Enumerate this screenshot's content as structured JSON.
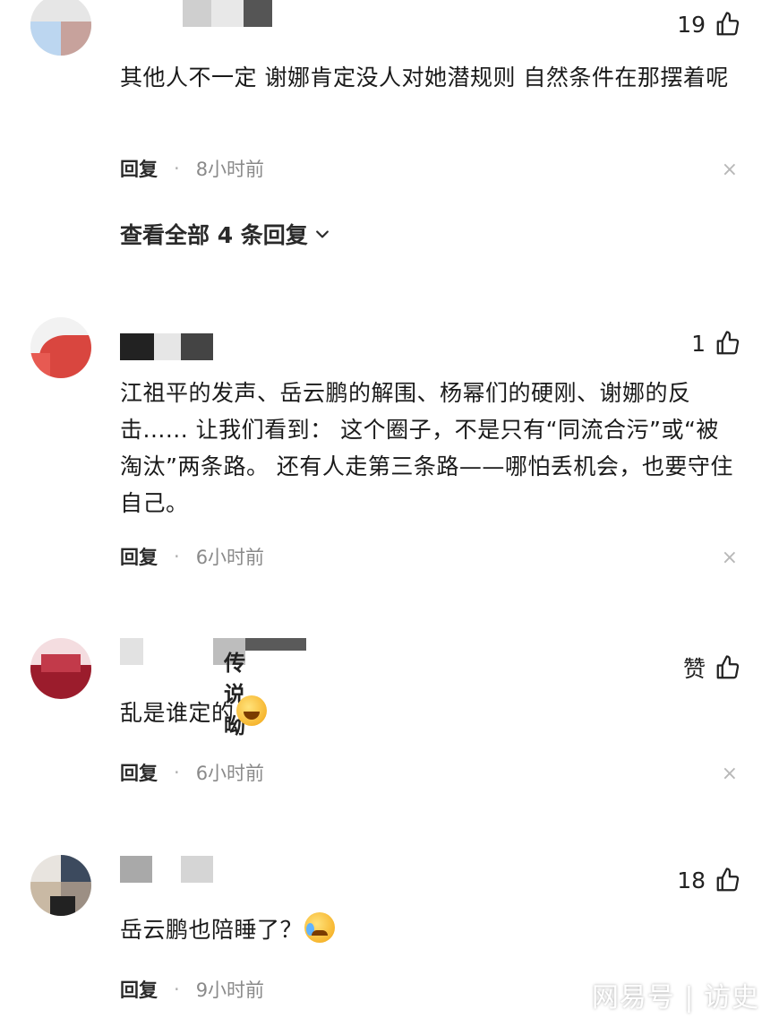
{
  "comments": [
    {
      "likes": "19",
      "text": "其他人不一定 谢娜肯定没人对她潜规则 自然条件在那摆着呢",
      "reply_label": "回复",
      "dot": "·",
      "time": "8小时前",
      "close": "×",
      "view_all": "查看全部 4 条回复"
    },
    {
      "likes": "1",
      "text": "江祖平的发声、岳云鹏的解围、杨幂们的硬刚、谢娜的反击...... 让我们看到： 这个圈子，不是只有“同流合污”或“被淘汰”两条路。 还有人走第三条路——哪怕丢机会，也要守住自己。",
      "reply_label": "回复",
      "dot": "·",
      "time": "6小时前",
      "close": "×"
    },
    {
      "username": "传说呦",
      "likes": "赞",
      "text": "乱是谁定的",
      "reply_label": "回复",
      "dot": "·",
      "time": "6小时前",
      "close": "×"
    },
    {
      "likes": "18",
      "text": "岳云鹏也陪睡了？",
      "reply_label": "回复",
      "dot": "·",
      "time": "9小时前"
    }
  ],
  "watermark": "网易号 | 访史",
  "icons": {
    "like": "thumbs-up-icon",
    "chevron": "chevron-down-icon",
    "close": "close-icon"
  }
}
